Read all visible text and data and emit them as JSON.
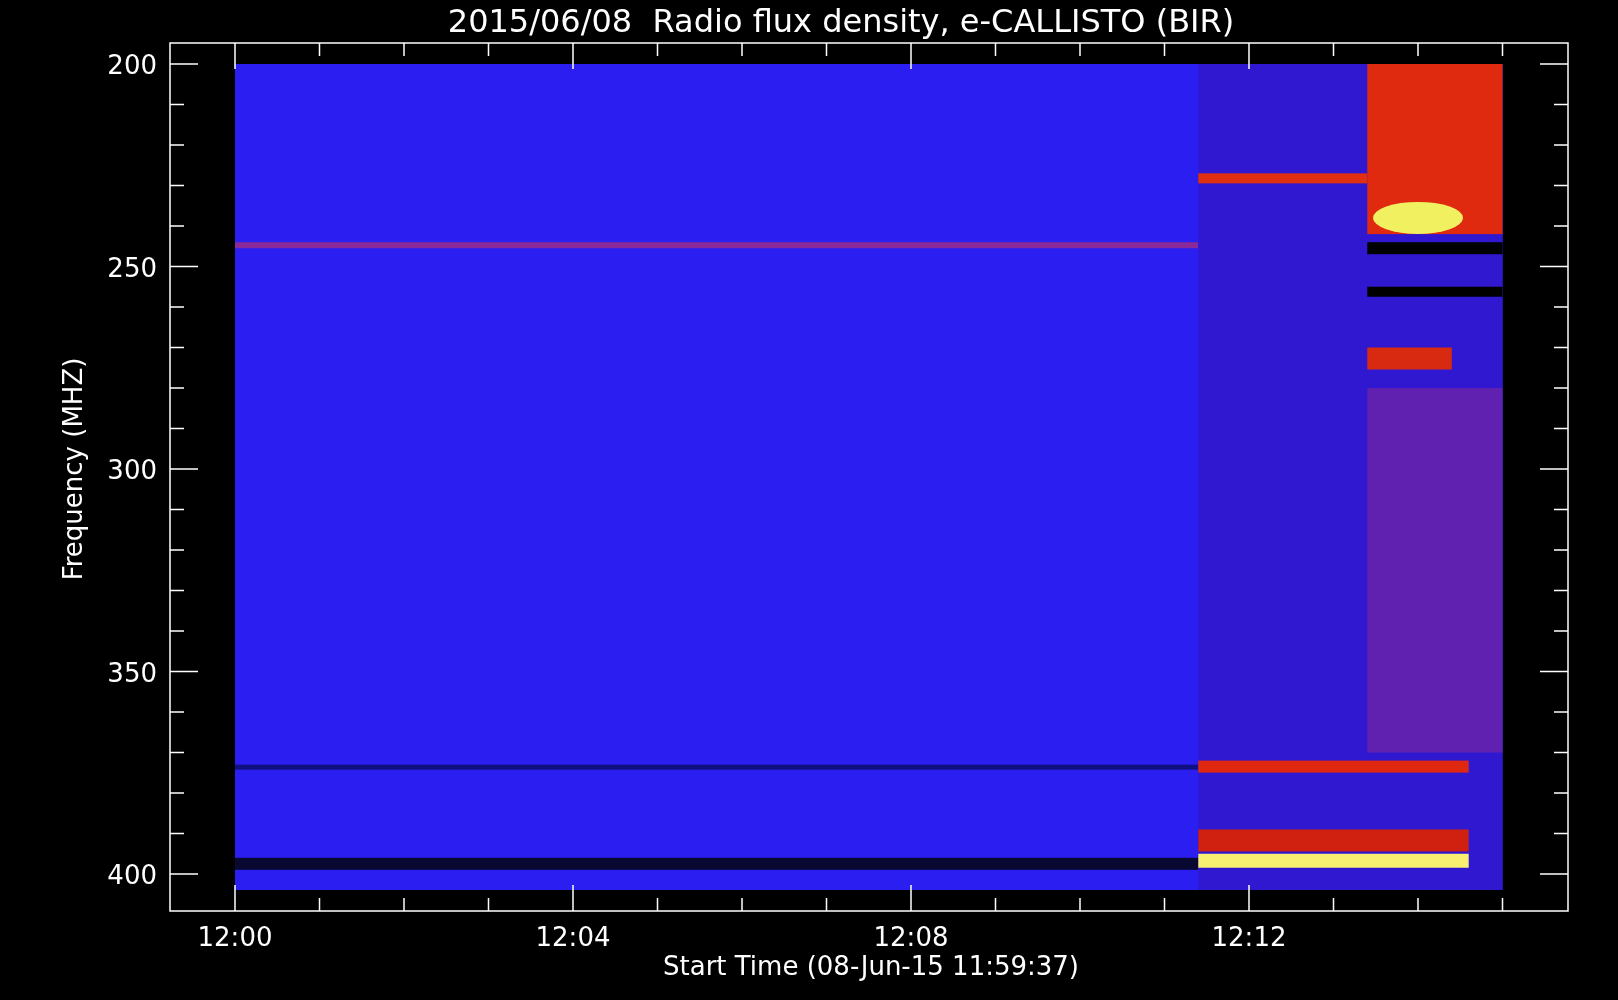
{
  "title": "2015/06/08  Radio flux density, e-CALLISTO (BIR)",
  "y_axis": {
    "label": "Frequency (MHZ)",
    "ticks": [
      "200",
      "250",
      "300",
      "350",
      "400"
    ]
  },
  "x_axis": {
    "label": "Start Time (08-Jun-15 11:59:37)",
    "ticks": [
      "12:00",
      "12:04",
      "12:08",
      "12:12"
    ]
  }
}
